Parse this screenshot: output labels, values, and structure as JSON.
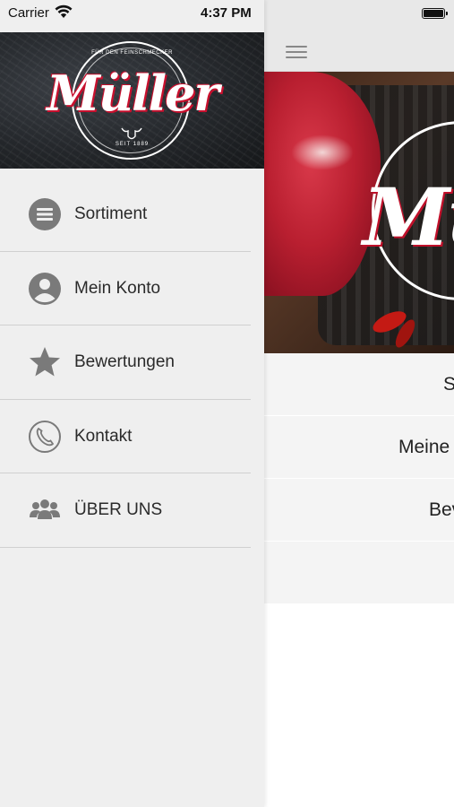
{
  "status_bar": {
    "carrier": "Carrier",
    "time": "4:37 PM"
  },
  "brand": {
    "logo_text": "Müller",
    "tagline": "FÜR DEN FEINSCHMECKER",
    "since": "SEIT 1889"
  },
  "drawer": {
    "items": [
      {
        "label": "Sortiment",
        "icon": "list-circle-icon"
      },
      {
        "label": "Mein Konto",
        "icon": "user-circle-icon"
      },
      {
        "label": "Bewertungen",
        "icon": "star-icon"
      },
      {
        "label": "Kontakt",
        "icon": "phone-icon"
      },
      {
        "label": "ÜBER UNS",
        "icon": "group-icon"
      }
    ]
  },
  "main": {
    "hero_logo_partial": "Mü",
    "rows": [
      {
        "label": "S"
      },
      {
        "label": "Meine"
      },
      {
        "label": "Bev"
      }
    ]
  },
  "colors": {
    "drawer_bg": "#efefef",
    "brand_red": "#c8102e",
    "icon_gray": "#7a7a7a",
    "text": "#2a2a2a"
  }
}
